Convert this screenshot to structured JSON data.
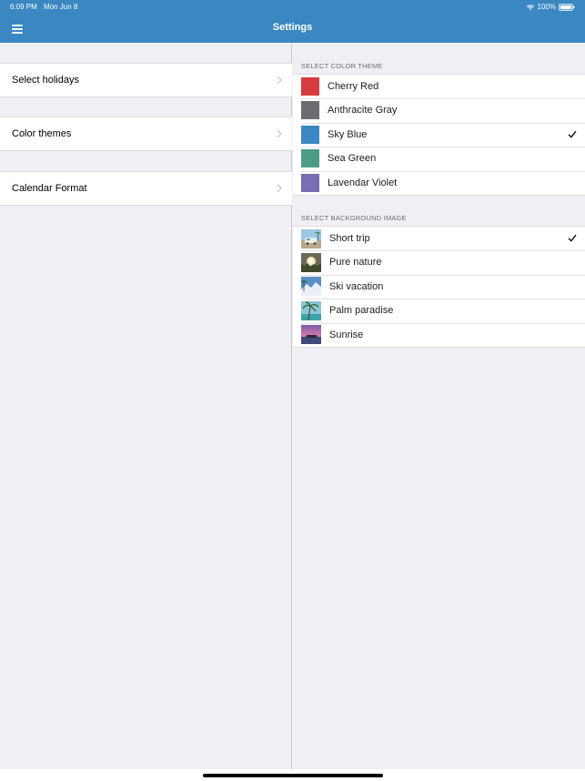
{
  "status_bar": {
    "time": "6:09 PM",
    "date": "Mon Jun 8",
    "battery": "100%"
  },
  "navbar": {
    "title": "Settings",
    "menu_icon": "hamburger-menu-icon"
  },
  "left_menu": {
    "items": [
      {
        "label": "Select holidays"
      },
      {
        "label": "Color themes"
      },
      {
        "label": "Calendar Format"
      }
    ]
  },
  "color_theme": {
    "header": "SELECT COLOR THEME",
    "options": [
      {
        "label": "Cherry Red",
        "color": "#d63b40",
        "selected": false
      },
      {
        "label": "Anthracite Gray",
        "color": "#6c6c73",
        "selected": false
      },
      {
        "label": "Sky Blue",
        "color": "#3a87c2",
        "selected": true
      },
      {
        "label": "Sea Green",
        "color": "#4f9c86",
        "selected": false
      },
      {
        "label": "Lavendar Violet",
        "color": "#7b6db2",
        "selected": false
      }
    ]
  },
  "background_image": {
    "header": "SELECT BACKGROUND IMAGE",
    "options": [
      {
        "label": "Short trip",
        "selected": true
      },
      {
        "label": "Pure nature",
        "selected": false
      },
      {
        "label": "Ski vacation",
        "selected": false
      },
      {
        "label": "Palm paradise",
        "selected": false
      },
      {
        "label": "Sunrise",
        "selected": false
      }
    ]
  }
}
